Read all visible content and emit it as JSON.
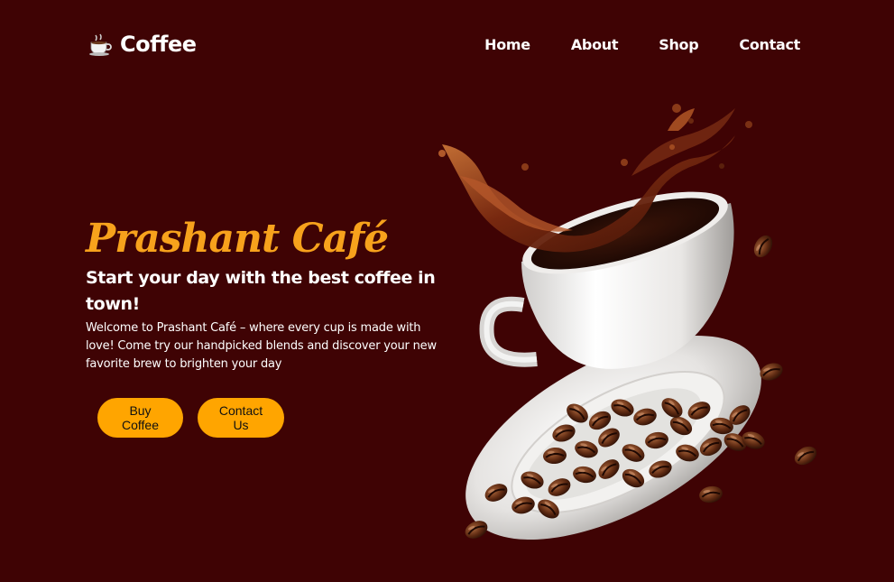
{
  "header": {
    "logo_text": "Coffee",
    "nav": [
      "Home",
      "About",
      "Shop",
      "Contact"
    ]
  },
  "hero": {
    "brand": "Prashant Café",
    "tagline": "Start your day with the best coffee in town!",
    "description": "Welcome to Prashant Café – where every cup is made with love! Come try our handpicked blends and discover your new favorite brew to brighten your day",
    "buttons": {
      "buy": "Buy Coffee",
      "contact": "Contact Us"
    }
  },
  "colors": {
    "background": "#3f0304",
    "accent": "#f7a21c",
    "button": "#ffa500"
  },
  "icons": {
    "logo": "coffee-cup-icon",
    "illustration": "coffee-cup-splash-with-beans"
  }
}
